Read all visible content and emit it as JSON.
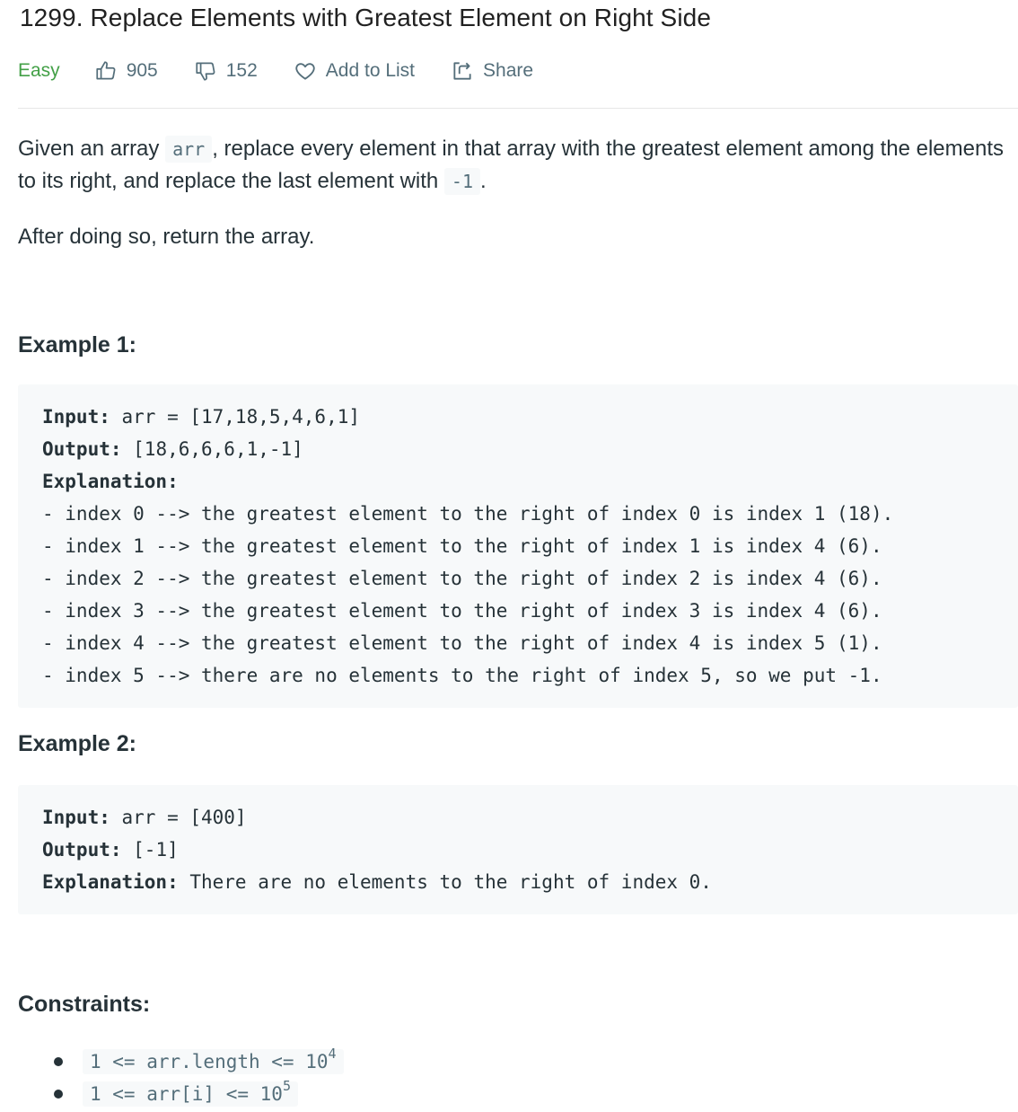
{
  "problem": {
    "title": "1299. Replace Elements with Greatest Element on Right Side",
    "difficulty": "Easy",
    "likes": "905",
    "dislikes": "152",
    "add_to_list_label": "Add to List",
    "share_label": "Share"
  },
  "description": {
    "p1_a": "Given an array ",
    "p1_code": "arr",
    "p1_b": ", replace every element in that array with the greatest element among the elements to its right, and replace the last element with ",
    "p1_code2": "-1",
    "p1_c": ".",
    "p2": "After doing so, return the array."
  },
  "example1": {
    "heading": "Example 1:",
    "input_label": "Input:",
    "input_value": " arr = [17,18,5,4,6,1]",
    "output_label": "Output:",
    "output_value": " [18,6,6,6,1,-1]",
    "explanation_label": "Explanation:",
    "lines": [
      "- index 0 --> the greatest element to the right of index 0 is index 1 (18).",
      "- index 1 --> the greatest element to the right of index 1 is index 4 (6).",
      "- index 2 --> the greatest element to the right of index 2 is index 4 (6).",
      "- index 3 --> the greatest element to the right of index 3 is index 4 (6).",
      "- index 4 --> the greatest element to the right of index 4 is index 5 (1).",
      "- index 5 --> there are no elements to the right of index 5, so we put -1."
    ]
  },
  "example2": {
    "heading": "Example 2:",
    "input_label": "Input:",
    "input_value": " arr = [400]",
    "output_label": "Output:",
    "output_value": " [-1]",
    "explanation_label": "Explanation:",
    "explanation_value": " There are no elements to the right of index 0."
  },
  "constraints": {
    "heading": "Constraints:",
    "items": [
      {
        "text": "1 <= arr.length <= 10",
        "exp": "4"
      },
      {
        "text": "1 <= arr[i] <= 10",
        "exp": "5"
      }
    ]
  },
  "colors": {
    "easy": "#43a047",
    "meta_text": "#546e7a",
    "code_bg": "#f7f9fa"
  }
}
